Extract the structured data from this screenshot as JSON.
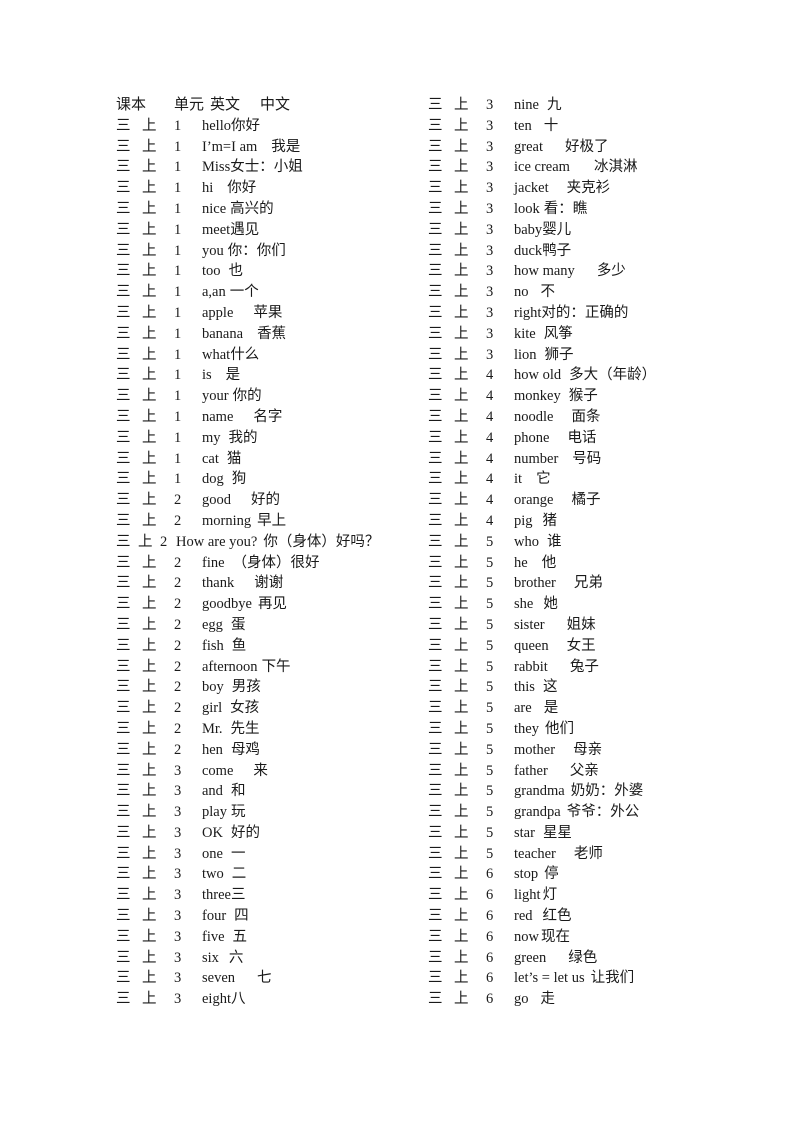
{
  "document": {
    "header": {
      "book": "课本",
      "unit": "单元",
      "english": "英文",
      "chinese": "中文"
    },
    "book_grade": "三",
    "book_term": "上",
    "left_column": [
      {
        "book": "三",
        "term": "上",
        "unit": "1",
        "en": "hello",
        "zh": "你好",
        "gap": 0
      },
      {
        "book": "三",
        "term": "上",
        "unit": "1",
        "en": "I’m=I am",
        "zh": "我是",
        "gap": 14
      },
      {
        "book": "三",
        "term": "上",
        "unit": "1",
        "en": "Miss",
        "zh": "女士：小姐",
        "gap": 0
      },
      {
        "book": "三",
        "term": "上",
        "unit": "1",
        "en": "hi",
        "zh": "你好",
        "gap": 14
      },
      {
        "book": "三",
        "term": "上",
        "unit": "1",
        "en": "nice",
        "zh": "高兴的",
        "gap": 4
      },
      {
        "book": "三",
        "term": "上",
        "unit": "1",
        "en": "meet",
        "zh": "遇见",
        "gap": 0
      },
      {
        "book": "三",
        "term": "上",
        "unit": "1",
        "en": "you",
        "zh": "你：你们",
        "gap": 4
      },
      {
        "book": "三",
        "term": "上",
        "unit": "1",
        "en": "too",
        "zh": "也",
        "gap": 8
      },
      {
        "book": "三",
        "term": "上",
        "unit": "1",
        "en": "a,an",
        "zh": "一个",
        "gap": 4
      },
      {
        "book": "三",
        "term": "上",
        "unit": "1",
        "en": "apple",
        "zh": "苹果",
        "gap": 20
      },
      {
        "book": "三",
        "term": "上",
        "unit": "1",
        "en": "banana",
        "zh": "香蕉",
        "gap": 14
      },
      {
        "book": "三",
        "term": "上",
        "unit": "1",
        "en": "what",
        "zh": "什么",
        "gap": 0
      },
      {
        "book": "三",
        "term": "上",
        "unit": "1",
        "en": "is",
        "zh": "是",
        "gap": 14
      },
      {
        "book": "三",
        "term": "上",
        "unit": "1",
        "en": "your",
        "zh": "你的",
        "gap": 4
      },
      {
        "book": "三",
        "term": "上",
        "unit": "1",
        "en": "name",
        "zh": "名字",
        "gap": 20
      },
      {
        "book": "三",
        "term": "上",
        "unit": "1",
        "en": "my",
        "zh": "我的",
        "gap": 8
      },
      {
        "book": "三",
        "term": "上",
        "unit": "1",
        "en": "cat",
        "zh": "猫",
        "gap": 8
      },
      {
        "book": "三",
        "term": "上",
        "unit": "1",
        "en": "dog",
        "zh": "狗",
        "gap": 8
      },
      {
        "book": "三",
        "term": "上",
        "unit": "2",
        "en": "good",
        "zh": "好的",
        "gap": 20
      },
      {
        "book": "三",
        "term": "上",
        "unit": "2",
        "en": "morning",
        "zh": "早上",
        "gap": 6
      },
      {
        "book": "三",
        "term": "上",
        "unit": "2",
        "en": "How are you?",
        "zh": "你（身体）好吗？",
        "gap": 6,
        "wide": true
      },
      {
        "book": "三",
        "term": "上",
        "unit": "2",
        "en": "fine",
        "zh": "（身体）很好",
        "gap": 8
      },
      {
        "book": "三",
        "term": "上",
        "unit": "2",
        "en": "thank",
        "zh": "谢谢",
        "gap": 20
      },
      {
        "book": "三",
        "term": "上",
        "unit": "2",
        "en": "goodbye",
        "zh": "再见",
        "gap": 6
      },
      {
        "book": "三",
        "term": "上",
        "unit": "2",
        "en": "egg",
        "zh": "蛋",
        "gap": 8
      },
      {
        "book": "三",
        "term": "上",
        "unit": "2",
        "en": "fish",
        "zh": "鱼",
        "gap": 8
      },
      {
        "book": "三",
        "term": "上",
        "unit": "2",
        "en": "afternoon",
        "zh": "下午",
        "gap": 4
      },
      {
        "book": "三",
        "term": "上",
        "unit": "2",
        "en": "boy",
        "zh": "男孩",
        "gap": 8
      },
      {
        "book": "三",
        "term": "上",
        "unit": "2",
        "en": "girl",
        "zh": "女孩",
        "gap": 8
      },
      {
        "book": "三",
        "term": "上",
        "unit": "2",
        "en": "Mr.",
        "zh": "先生",
        "gap": 8
      },
      {
        "book": "三",
        "term": "上",
        "unit": "2",
        "en": "hen",
        "zh": "母鸡",
        "gap": 8
      },
      {
        "book": "三",
        "term": "上",
        "unit": "3",
        "en": "come",
        "zh": "来",
        "gap": 20
      },
      {
        "book": "三",
        "term": "上",
        "unit": "3",
        "en": "and",
        "zh": "和",
        "gap": 8
      },
      {
        "book": "三",
        "term": "上",
        "unit": "3",
        "en": "play",
        "zh": "玩",
        "gap": 4
      },
      {
        "book": "三",
        "term": "上",
        "unit": "3",
        "en": "OK",
        "zh": "好的",
        "gap": 8
      },
      {
        "book": "三",
        "term": "上",
        "unit": "3",
        "en": "one",
        "zh": "一",
        "gap": 8
      },
      {
        "book": "三",
        "term": "上",
        "unit": "3",
        "en": "two",
        "zh": "二",
        "gap": 8
      },
      {
        "book": "三",
        "term": "上",
        "unit": "3",
        "en": "three",
        "zh": "三",
        "gap": 0
      },
      {
        "book": "三",
        "term": "上",
        "unit": "3",
        "en": "four",
        "zh": "四",
        "gap": 8
      },
      {
        "book": "三",
        "term": "上",
        "unit": "3",
        "en": "five",
        "zh": "五",
        "gap": 8
      },
      {
        "book": "三",
        "term": "上",
        "unit": "3",
        "en": "six",
        "zh": "六",
        "gap": 10
      },
      {
        "book": "三",
        "term": "上",
        "unit": "3",
        "en": "seven",
        "zh": "七",
        "gap": 22
      },
      {
        "book": "三",
        "term": "上",
        "unit": "3",
        "en": "eight",
        "zh": "八",
        "gap": 0
      }
    ],
    "right_column": [
      {
        "book": "三",
        "term": "上",
        "unit": "3",
        "en": "nine",
        "zh": "九",
        "gap": 8
      },
      {
        "book": "三",
        "term": "上",
        "unit": "3",
        "en": "ten",
        "zh": "十",
        "gap": 12
      },
      {
        "book": "三",
        "term": "上",
        "unit": "3",
        "en": "great",
        "zh": "好极了",
        "gap": 22
      },
      {
        "book": "三",
        "term": "上",
        "unit": "3",
        "en": "ice cream",
        "zh": "冰淇淋",
        "gap": 24
      },
      {
        "book": "三",
        "term": "上",
        "unit": "3",
        "en": "jacket",
        "zh": "夹克衫",
        "gap": 18
      },
      {
        "book": "三",
        "term": "上",
        "unit": "3",
        "en": "look",
        "zh": "看：瞧",
        "gap": 4
      },
      {
        "book": "三",
        "term": "上",
        "unit": "3",
        "en": "baby",
        "zh": "婴儿",
        "gap": 0
      },
      {
        "book": "三",
        "term": "上",
        "unit": "3",
        "en": "duck",
        "zh": "鸭子",
        "gap": 0
      },
      {
        "book": "三",
        "term": "上",
        "unit": "3",
        "en": "how many",
        "zh": "多少",
        "gap": 22
      },
      {
        "book": "三",
        "term": "上",
        "unit": "3",
        "en": "no",
        "zh": "不",
        "gap": 12
      },
      {
        "book": "三",
        "term": "上",
        "unit": "3",
        "en": "right",
        "zh": "对的：正确的",
        "gap": 0
      },
      {
        "book": "三",
        "term": "上",
        "unit": "3",
        "en": "kite",
        "zh": "风筝",
        "gap": 8
      },
      {
        "book": "三",
        "term": "上",
        "unit": "3",
        "en": "lion",
        "zh": "狮子",
        "gap": 8
      },
      {
        "book": "三",
        "term": "上",
        "unit": "4",
        "en": "how old",
        "zh": "多大（年龄）",
        "gap": 8
      },
      {
        "book": "三",
        "term": "上",
        "unit": "4",
        "en": "monkey",
        "zh": "猴子",
        "gap": 8
      },
      {
        "book": "三",
        "term": "上",
        "unit": "4",
        "en": "noodle",
        "zh": "面条",
        "gap": 18
      },
      {
        "book": "三",
        "term": "上",
        "unit": "4",
        "en": "phone",
        "zh": "电话",
        "gap": 18
      },
      {
        "book": "三",
        "term": "上",
        "unit": "4",
        "en": "number",
        "zh": "号码",
        "gap": 14
      },
      {
        "book": "三",
        "term": "上",
        "unit": "4",
        "en": "it",
        "zh": "它",
        "gap": 14
      },
      {
        "book": "三",
        "term": "上",
        "unit": "4",
        "en": "orange",
        "zh": "橘子",
        "gap": 18
      },
      {
        "book": "三",
        "term": "上",
        "unit": "4",
        "en": "pig",
        "zh": "猪",
        "gap": 10
      },
      {
        "book": "三",
        "term": "上",
        "unit": "5",
        "en": "who",
        "zh": "谁",
        "gap": 8
      },
      {
        "book": "三",
        "term": "上",
        "unit": "5",
        "en": "he",
        "zh": "他",
        "gap": 14
      },
      {
        "book": "三",
        "term": "上",
        "unit": "5",
        "en": "brother",
        "zh": "兄弟",
        "gap": 18
      },
      {
        "book": "三",
        "term": "上",
        "unit": "5",
        "en": "she",
        "zh": "她",
        "gap": 10
      },
      {
        "book": "三",
        "term": "上",
        "unit": "5",
        "en": "sister",
        "zh": "姐妹",
        "gap": 22
      },
      {
        "book": "三",
        "term": "上",
        "unit": "5",
        "en": "queen",
        "zh": "女王",
        "gap": 18
      },
      {
        "book": "三",
        "term": "上",
        "unit": "5",
        "en": "rabbit",
        "zh": "兔子",
        "gap": 22
      },
      {
        "book": "三",
        "term": "上",
        "unit": "5",
        "en": "this",
        "zh": "这",
        "gap": 8
      },
      {
        "book": "三",
        "term": "上",
        "unit": "5",
        "en": "are",
        "zh": "是",
        "gap": 12
      },
      {
        "book": "三",
        "term": "上",
        "unit": "5",
        "en": "they",
        "zh": "他们",
        "gap": 6
      },
      {
        "book": "三",
        "term": "上",
        "unit": "5",
        "en": "mother",
        "zh": "母亲",
        "gap": 18
      },
      {
        "book": "三",
        "term": "上",
        "unit": "5",
        "en": "father",
        "zh": "父亲",
        "gap": 22
      },
      {
        "book": "三",
        "term": "上",
        "unit": "5",
        "en": "grandma",
        "zh": "奶奶：外婆",
        "gap": 6
      },
      {
        "book": "三",
        "term": "上",
        "unit": "5",
        "en": "grandpa",
        "zh": "爷爷：外公",
        "gap": 6
      },
      {
        "book": "三",
        "term": "上",
        "unit": "5",
        "en": "star",
        "zh": "星星",
        "gap": 8
      },
      {
        "book": "三",
        "term": "上",
        "unit": "5",
        "en": "teacher",
        "zh": "老师",
        "gap": 18
      },
      {
        "book": "三",
        "term": "上",
        "unit": "6",
        "en": "stop",
        "zh": "停",
        "gap": 6
      },
      {
        "book": "三",
        "term": "上",
        "unit": "6",
        "en": "light",
        "zh": "灯",
        "gap": 2
      },
      {
        "book": "三",
        "term": "上",
        "unit": "6",
        "en": "red",
        "zh": "红色",
        "gap": 10
      },
      {
        "book": "三",
        "term": "上",
        "unit": "6",
        "en": "now",
        "zh": "现在",
        "gap": 2
      },
      {
        "book": "三",
        "term": "上",
        "unit": "6",
        "en": "green",
        "zh": "绿色",
        "gap": 22
      },
      {
        "book": "三",
        "term": "上",
        "unit": "6",
        "en": "let’s = let us",
        "zh": "让我们",
        "gap": 6
      },
      {
        "book": "三",
        "term": "上",
        "unit": "6",
        "en": "go",
        "zh": "走",
        "gap": 12
      }
    ]
  }
}
